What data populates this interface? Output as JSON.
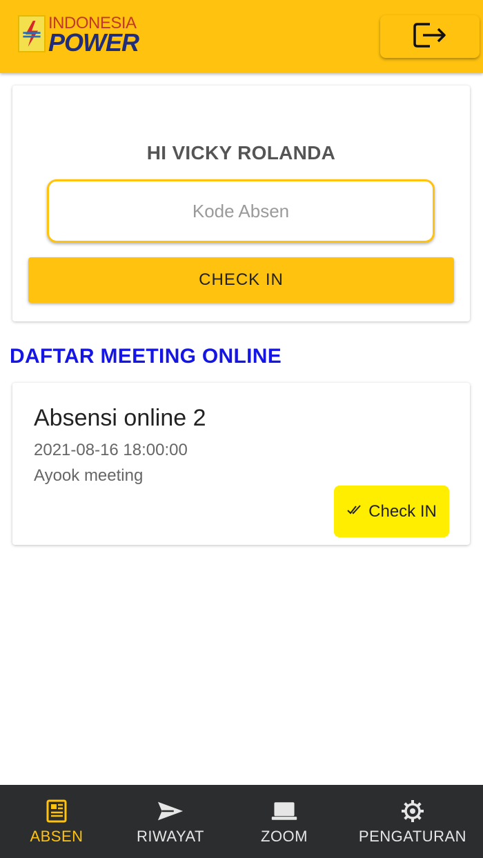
{
  "header": {
    "logo_top": "INDONESIA",
    "logo_bottom": "POWER",
    "logout_icon": "logout-icon"
  },
  "checkin": {
    "greeting": "HI VICKY ROLANDA",
    "code_placeholder": "Kode Absen",
    "code_value": "",
    "button_label": "CHECK IN"
  },
  "section_title": "DAFTAR MEETING ONLINE",
  "meetings": [
    {
      "title": "Absensi online 2",
      "datetime": "2021-08-16 18:00:00",
      "description": "Ayook meeting",
      "button_label": "Check IN",
      "button_icon": "double-check-icon"
    }
  ],
  "nav": {
    "items": [
      {
        "label": "ABSEN",
        "icon": "newspaper-icon",
        "active": true
      },
      {
        "label": "RIWAYAT",
        "icon": "send-icon",
        "active": false
      },
      {
        "label": "ZOOM",
        "icon": "laptop-icon",
        "active": false
      },
      {
        "label": "PENGATURAN",
        "icon": "gear-icon",
        "active": false
      }
    ]
  },
  "colors": {
    "brand_yellow": "#ffc20e",
    "checkin_yellow": "#ffee00",
    "section_blue": "#1515e6",
    "nav_bg": "#2b2d2f"
  }
}
